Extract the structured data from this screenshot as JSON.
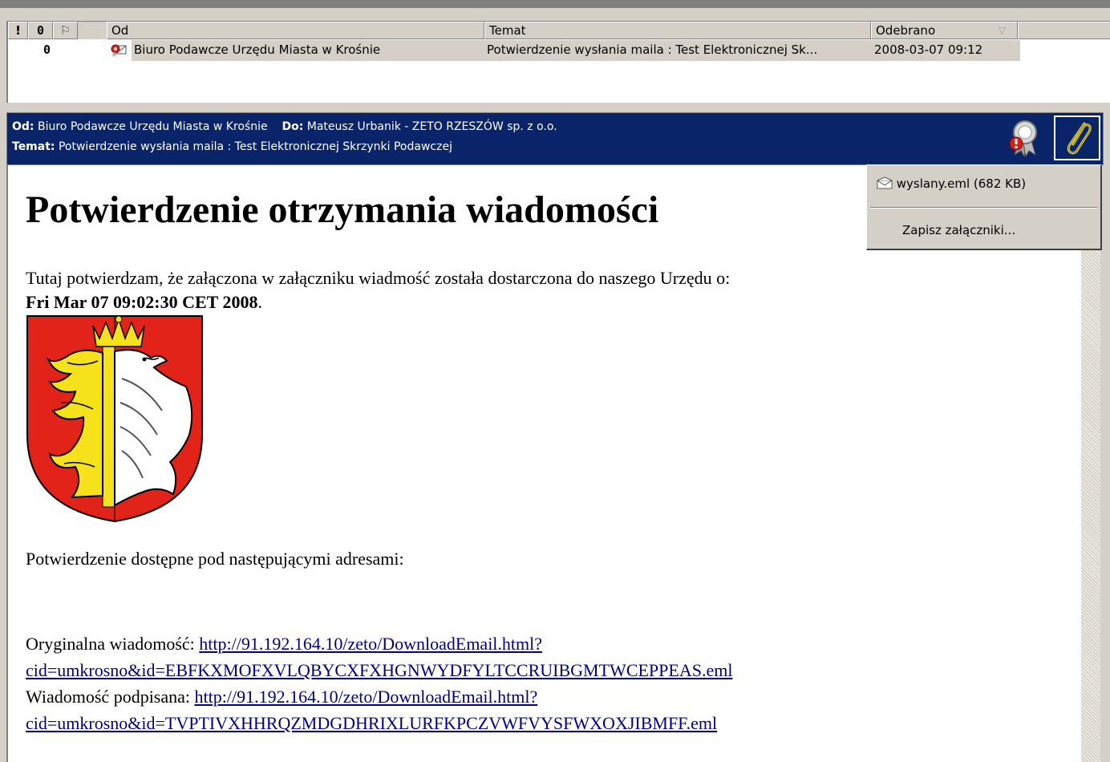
{
  "list": {
    "columns": {
      "importance": "!",
      "attachment": "0",
      "flag": "⚐",
      "from": "Od",
      "subject": "Temat",
      "received": "Odebrano",
      "received_sort": "▽"
    },
    "rows": [
      {
        "attachment": "0",
        "from": "Biuro Podawcze Urzędu Miasta w Krośnie",
        "subject": "Potwierdzenie wysłania maila : Test Elektronicznej Sk...",
        "received": "2008-03-07 09:12"
      }
    ]
  },
  "preview": {
    "from_label": "Od:",
    "from_value": "Biuro Podawcze Urzędu Miasta w Krośnie",
    "to_label": "Do:",
    "to_value": "Mateusz Urbanik - ZETO RZESZÓW sp. z o.o.",
    "subject_label": "Temat:",
    "subject_value": "Potwierdzenie wysłania maila : Test Elektronicznej Skrzynki Podawczej"
  },
  "message": {
    "heading": "Potwierdzenie otrzymania wiadomości",
    "intro": "Tutaj potwierdzam, że załączona w załączniku wiadmość została dostarczona do naszego Urzędu o:",
    "timestamp": "Fri Mar 07 09:02:30 CET 2008",
    "timestamp_suffix": ".",
    "addresses_intro": "Potwierdzenie dostępne pod następującymi adresami:",
    "original_label": "Oryginalna wiadomość: ",
    "original_link_1": "http://91.192.164.10/zeto/DownloadEmail.html?",
    "original_link_2": "cid=umkrosno&id=EBFKXMOFXVLQBYCXFXHGNWYDFYLTCCRUIBGMTWCEPPEAS.eml",
    "signed_label": "Wiadomość podpisana: ",
    "signed_link_1": "http://91.192.164.10/zeto/DownloadEmail.html?",
    "signed_link_2": "cid=umkrosno&id=TVPTIVXHHRQZMDGDHRIXLURFKPCZVWFVYSFWXOXJIBMFF.eml"
  },
  "attachments_menu": {
    "file": "wyslany.eml (682 KB)",
    "save_all": "Zapisz załączniki..."
  },
  "colors": {
    "header_bg": "#0a246a",
    "link": "#00008b",
    "coat_red": "#e2231a",
    "coat_yellow": "#f5e11c"
  }
}
